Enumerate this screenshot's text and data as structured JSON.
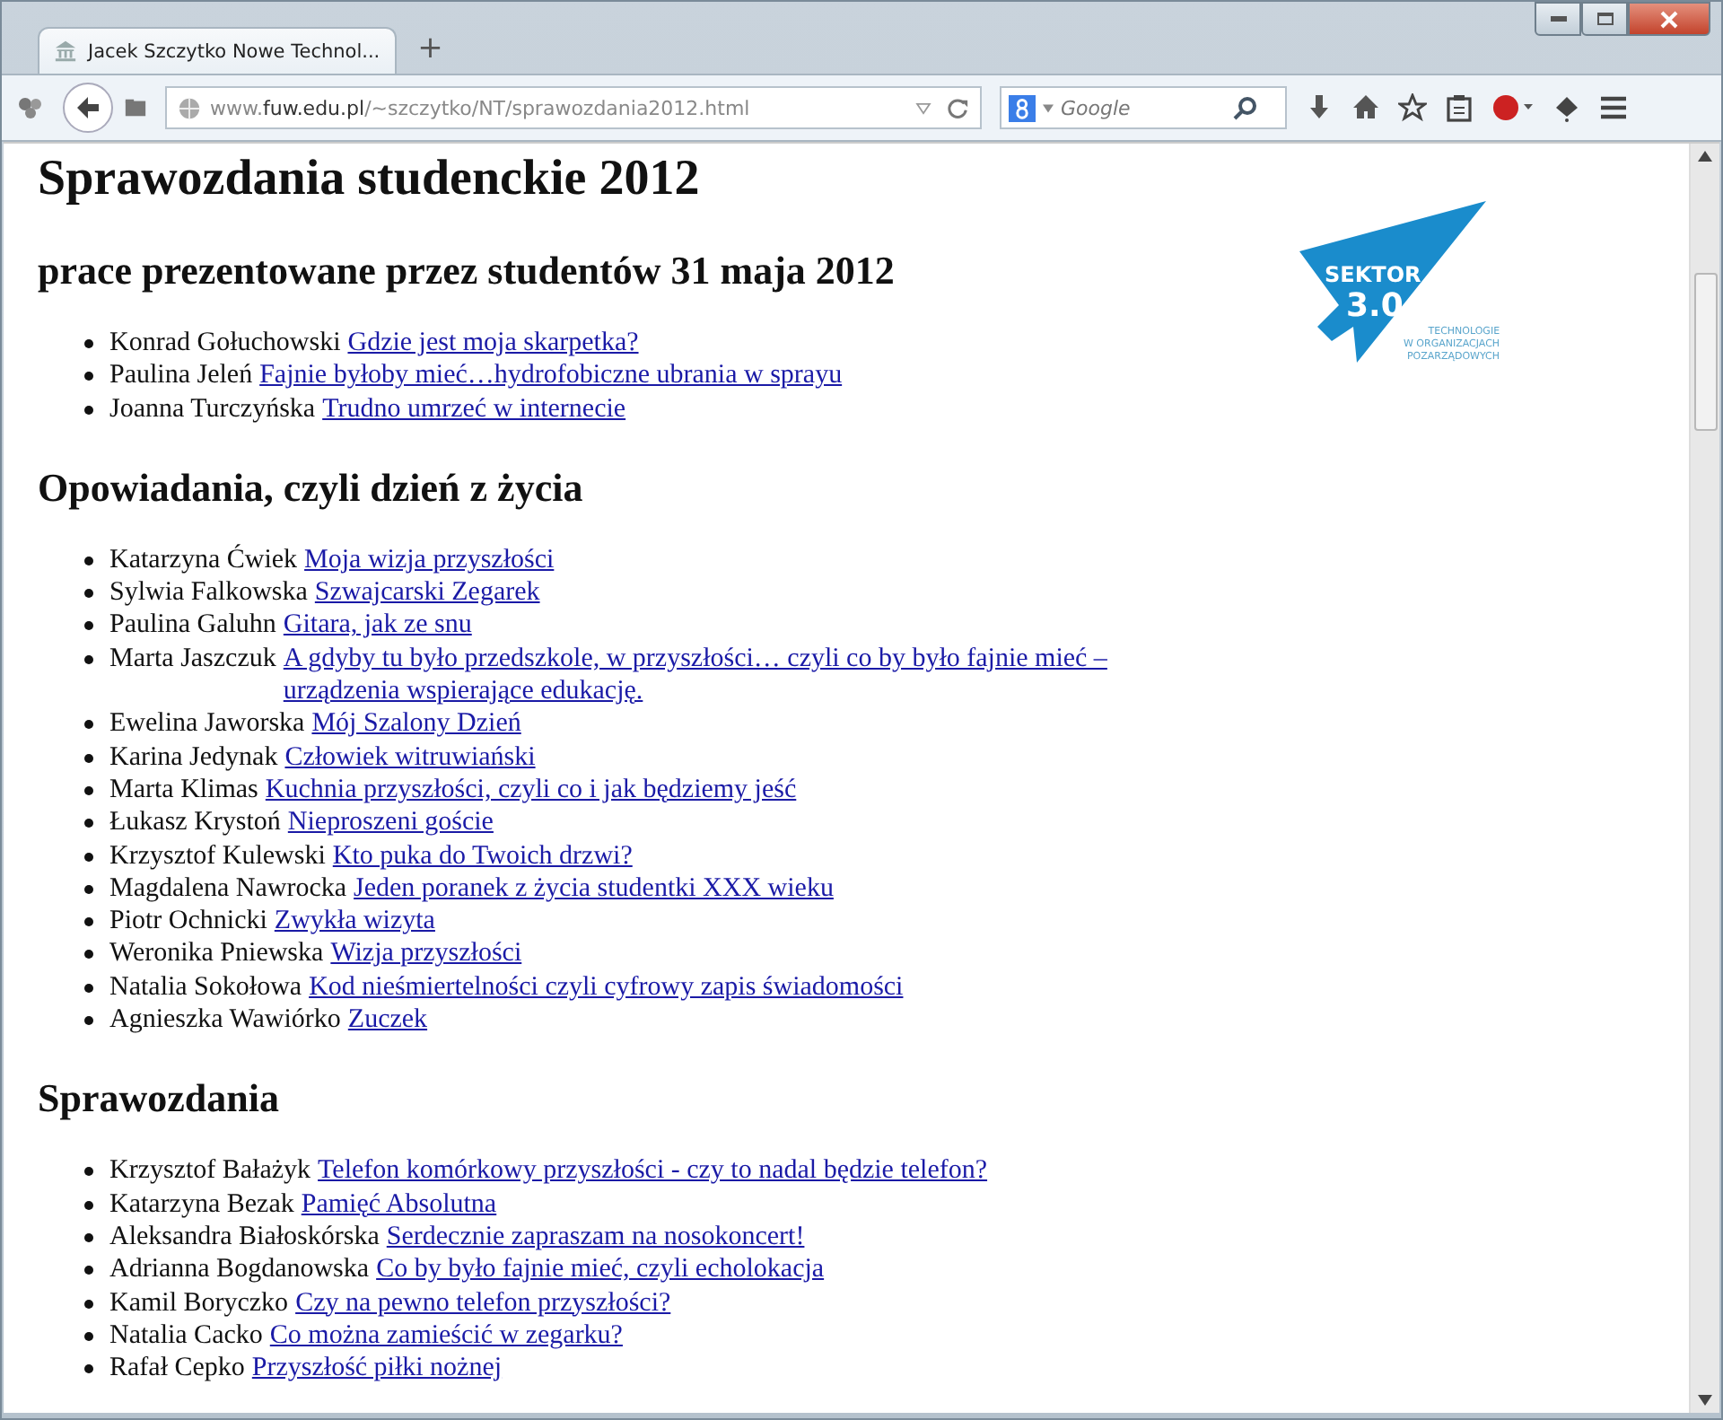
{
  "window": {
    "tab_title": "Jacek Szczytko Nowe Technol...",
    "new_tab": "+"
  },
  "toolbar": {
    "url": "www.**fuw.edu.pl**/~szczytko/NT/sprawozdania2012.html",
    "search_placeholder": "Google"
  },
  "page": {
    "title": "Sprawozdania studenckie 2012",
    "logo": {
      "name": "SEKTOR",
      "version": "3.0",
      "tagline": [
        "TECHNOLOGIE",
        "W ORGANIZACJACH",
        "POZARZĄDOWYCH"
      ]
    },
    "sections": [
      {
        "heading": "prace prezentowane przez studentów 31 maja 2012",
        "items": [
          {
            "author": "Konrad Gołuchowski",
            "link": "Gdzie jest moja skarpetka?"
          },
          {
            "author": "Paulina Jeleń",
            "link": "Fajnie byłoby mieć…hydrofobiczne ubrania w sprayu"
          },
          {
            "author": "Joanna Turczyńska",
            "link": "Trudno umrzeć w internecie"
          }
        ]
      },
      {
        "heading": "Opowiadania, czyli dzień z życia",
        "items": [
          {
            "author": "Katarzyna Ćwiek",
            "link": "Moja wizja przyszłości"
          },
          {
            "author": "Sylwia Falkowska",
            "link": "Szwajcarski Zegarek"
          },
          {
            "author": "Paulina Galuhn",
            "link": "Gitara, jak ze snu"
          },
          {
            "author": "Marta Jaszczuk",
            "link": "A gdyby tu było przedszkole, w przyszłości… czyli co by było fajnie mieć – urządzenia wspierające edukację."
          },
          {
            "author": "Ewelina Jaworska",
            "link": "Mój Szalony Dzień"
          },
          {
            "author": "Karina Jedynak",
            "link": "Człowiek witruwiański"
          },
          {
            "author": "Marta Klimas",
            "link": "Kuchnia przyszłości, czyli co i jak będziemy jeść"
          },
          {
            "author": "Łukasz Krystoń",
            "link": "Nieproszeni goście"
          },
          {
            "author": "Krzysztof Kulewski",
            "link": "Kto puka do Twoich drzwi?"
          },
          {
            "author": "Magdalena Nawrocka",
            "link": "Jeden poranek z życia studentki XXX wieku"
          },
          {
            "author": "Piotr Ochnicki",
            "link": "Zwykła wizyta"
          },
          {
            "author": "Weronika Pniewska",
            "link": "Wizja przyszłości"
          },
          {
            "author": "Natalia Sokołowa",
            "link": "Kod nieśmiertelności czyli cyfrowy zapis świadomości"
          },
          {
            "author": "Agnieszka Wawiórko",
            "link": "Zuczek"
          }
        ]
      },
      {
        "heading": "Sprawozdania",
        "items": [
          {
            "author": "Krzysztof Bałażyk",
            "link": "Telefon komórkowy przyszłości - czy to nadal będzie telefon?"
          },
          {
            "author": "Katarzyna Bezak",
            "link": "Pamięć Absolutna"
          },
          {
            "author": "Aleksandra Białoskórska",
            "link": "Serdecznie zapraszam na nosokoncert!"
          },
          {
            "author": "Adrianna Bogdanowska",
            "link": "Co by było fajnie mieć, czyli echolokacja"
          },
          {
            "author": "Kamil Boryczko",
            "link": "Czy na pewno telefon przyszłości?"
          },
          {
            "author": "Natalia Cacko",
            "link": "Co można zamieścić w zegarku?"
          },
          {
            "author": "Rafał Cepko",
            "link": "Przyszłość piłki nożnej"
          }
        ]
      }
    ]
  }
}
